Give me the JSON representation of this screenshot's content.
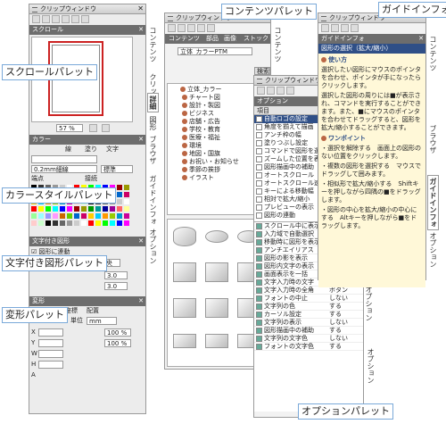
{
  "clip_title": "クリップウィンドウ",
  "scroll": {
    "header": "スクロール",
    "zoom": "57 %"
  },
  "color": {
    "header": "カラー",
    "tabs": [
      "線",
      "塗り",
      "文字"
    ],
    "line_width": "0.2mm細線",
    "line_style": "標準",
    "corner": "端点",
    "join": "接続"
  },
  "textshape": {
    "header": "文字付き図形",
    "link": "図形に連動",
    "align": "配置",
    "h": "中央",
    "v": "中央",
    "v1": "3.0",
    "v2": "3.0"
  },
  "transform": {
    "header": "変形",
    "tabs": [
      "座標",
      "配置"
    ],
    "unit_label": "単位",
    "unit": "mm",
    "fields": [
      "X",
      "Y",
      "W",
      "H",
      "A"
    ],
    "pct": "100 %"
  },
  "contents": {
    "title": "コンテンツパレット",
    "tabs": [
      "コンテンツ",
      "部品",
      "画像",
      "ストック"
    ],
    "font": "立体_カラーPTM",
    "search": "検索",
    "items": [
      "立体_カラー",
      "チャート図",
      "設計・製図",
      "ビジネス",
      "店舗・広告",
      "学校・教育",
      "医療・福祉",
      "環境",
      "地図・国旗",
      "お祝い・お知らせ",
      "季節の挨拶",
      "イラスト"
    ]
  },
  "option": {
    "title": "オプションパレット",
    "header": "オプション",
    "col": "項目",
    "items": [
      "自動ロゴの設定",
      "角度を揃えて描画",
      "アンチ枠の幅",
      "塗りつぶし設定",
      "コマンドで図形を選択",
      "ズームした位置を表示",
      "図形描画中の補助",
      "オートスクロール",
      "オートスクロール速度",
      "キーによる移動幅",
      "相対で拡大/縮小",
      "プレビューの表示",
      "図形の連動"
    ],
    "rows": [
      [
        "スクロール中に表示",
        "する"
      ],
      [
        "入力域で自動選択",
        "しない"
      ],
      [
        "移動時に図形を表示",
        "する"
      ],
      [
        "アンチエイリアス",
        "する"
      ],
      [
        "図形の影を表示",
        "する"
      ],
      [
        "図形内文字の表示",
        "する"
      ],
      [
        "画面表示を一括",
        "しない"
      ],
      [
        "文字入力時の文字",
        "する"
      ],
      [
        "文字入力時の全角",
        "ボタン"
      ],
      [
        "フォントの中止",
        "しない"
      ],
      [
        "文字列の色",
        "する"
      ],
      [
        "カーソル設定",
        "する"
      ],
      [
        "文字列の表示",
        "しない"
      ],
      [
        "図形描画中の補助",
        "する"
      ],
      [
        "文字列の文字色",
        "しない"
      ],
      [
        "フォントの文字色",
        "する"
      ]
    ]
  },
  "guide": {
    "title": "ガイドインフォ",
    "header": "ガイドインフォ",
    "subhdr": "図形の選択（拡大/縮小）",
    "sec1": "使い方",
    "text1": "選択したい図形にマウスのポインタを合わせ、ポインタが手になったらクリックします。",
    "text2": "選択した図形の周りには■が表示され、コマンドを実行することができます。また、■にマウスのポインタを合わせてドラッグすると、図形を拡大/縮小することができます。",
    "sec2": "ワンポイント",
    "b1": "・選択を解除する　画面上の図形のない位置をクリックします。",
    "b2": "・複数の図形を選択する　マウスでドラッグして囲みます。",
    "b3": "・相似形で拡大/縮小する　Shiftキーを押しながら四隅の■をドラッグします。",
    "b4": "・図形の中心を拡大/縮小の中心にする　Altキーを押しながら■をドラッグします。"
  },
  "vtabs": {
    "contents": "コンテンツ",
    "clip": "クリップ",
    "detail": "詳細",
    "shape": "図形",
    "brows": "ブラウザ",
    "guide": "ガイドインフォ",
    "option": "オプション",
    "option2": "オプション",
    "contents2": "コンテンツ",
    "brows2": "ブラウザ",
    "guide2": "ガイドインフォ",
    "option3": "オプション",
    "kanri": "管理"
  },
  "callouts": {
    "scroll": "スクロールパレット",
    "color": "カラースタイルパレット",
    "textshape": "文字付き図形パレット",
    "transform": "変形パレット",
    "contents": "コンテンツパレット",
    "guide": "ガイドインフォ",
    "option": "オプションパレット"
  }
}
